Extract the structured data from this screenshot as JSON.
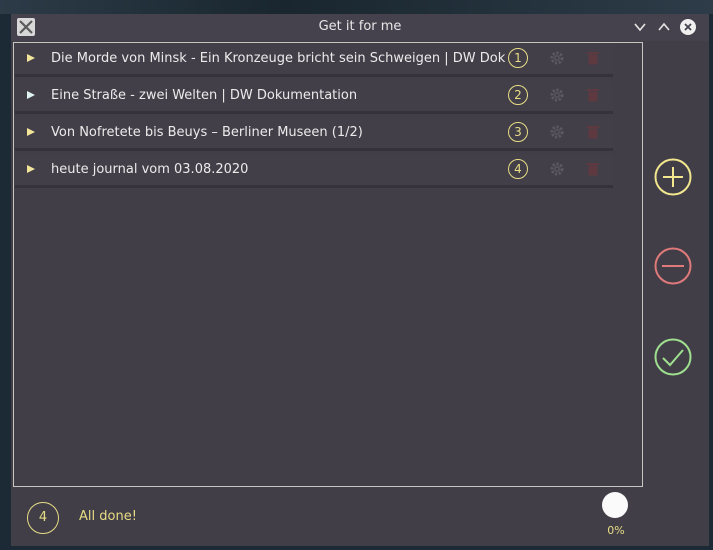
{
  "window": {
    "title": "Get it for me"
  },
  "titlebar": {
    "app_icon": "app-x-icon",
    "controls": [
      "minimize-chevron-down-icon",
      "maximize-chevron-up-icon",
      "close-icon"
    ]
  },
  "downloads": [
    {
      "title": "Die Morde von Minsk - Ein Kronzeuge bricht sein Schweigen | DW Dok",
      "index": "1"
    },
    {
      "title": "Eine Straße - zwei Welten | DW Dokumentation",
      "index": "2"
    },
    {
      "title": "Von Nofretete bis Beuys – Berliner Museen (1/2)",
      "index": "3"
    },
    {
      "title": "heute journal vom 03.08.2020",
      "index": "4"
    }
  ],
  "sidebar": {
    "buttons": [
      "plus-icon",
      "minus-icon",
      "check-icon"
    ]
  },
  "footer": {
    "count": "4",
    "status": "All done!",
    "progress": 0,
    "progress_label": "0%"
  },
  "colors": {
    "window_bg": "#413e48",
    "accent_yellow": "#e8dd85",
    "add_yellow": "#f2e68f",
    "remove_red": "#e07a7a",
    "confirm_green": "#9fe08f"
  }
}
